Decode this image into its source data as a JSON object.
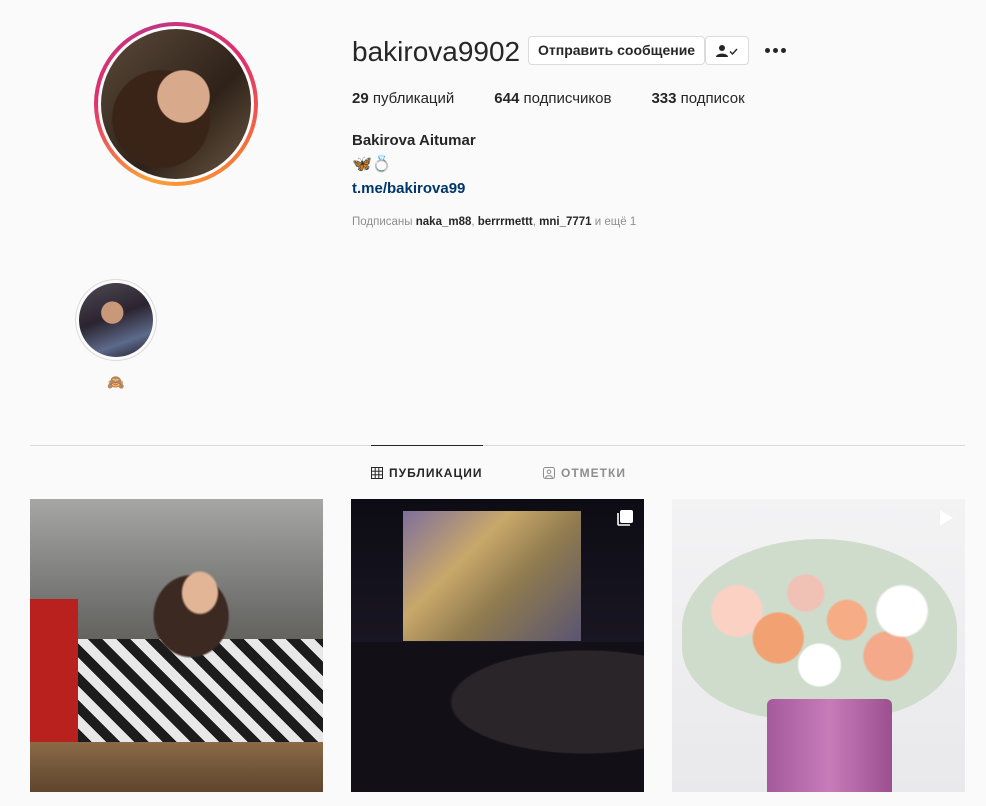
{
  "profile": {
    "username": "bakirova9902",
    "message_button": "Отправить сообщение",
    "full_name": "Bakirova Aitumar",
    "bio_emoji": "🦋💍",
    "link": "t.me/bakirova99",
    "stats": {
      "posts_count": "29",
      "posts_label": "публикаций",
      "followers_count": "644",
      "followers_label": "подписчиков",
      "following_count": "333",
      "following_label": "подписок"
    },
    "followed_by": {
      "prefix": "Подписаны",
      "accounts": [
        "naka_m88",
        "berrrmettt",
        "mni_7771"
      ],
      "suffix": "и ещё 1"
    }
  },
  "highlights": [
    {
      "label": "🙈"
    }
  ],
  "tabs": [
    {
      "label": "ПУБЛИКАЦИИ",
      "icon": "grid-icon",
      "active": true
    },
    {
      "label": "ОТМЕТКИ",
      "icon": "tagged-icon",
      "active": false
    }
  ],
  "posts": [
    {
      "kind": "photo",
      "badge": ""
    },
    {
      "kind": "carousel",
      "badge": "carousel-icon"
    },
    {
      "kind": "video",
      "badge": "video-icon"
    }
  ],
  "colors": {
    "link": "#00376b",
    "muted": "#8e8e8e",
    "border": "#dbdbdb",
    "text": "#262626"
  }
}
